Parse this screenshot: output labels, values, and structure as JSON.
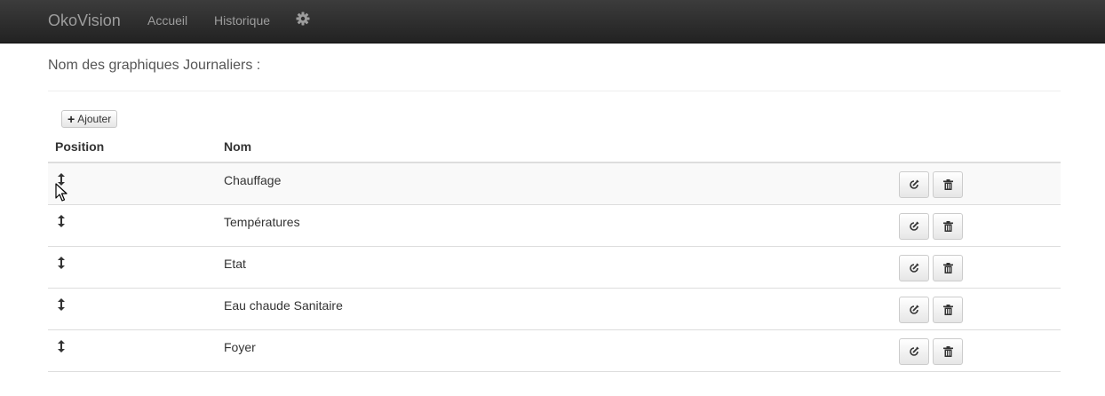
{
  "navbar": {
    "brand": "OkoVision",
    "links": [
      {
        "label": "Accueil"
      },
      {
        "label": "Historique"
      }
    ],
    "settings_icon": "gear-icon"
  },
  "page": {
    "heading": "Nom des graphiques Journaliers :"
  },
  "toolbar": {
    "add_label": "Ajouter",
    "add_icon": "plus-icon"
  },
  "table": {
    "columns": [
      "Position",
      "Nom"
    ],
    "rows": [
      {
        "name": "Chauffage"
      },
      {
        "name": "Températures"
      },
      {
        "name": "Etat"
      },
      {
        "name": "Eau chaude Sanitaire"
      },
      {
        "name": "Foyer"
      }
    ],
    "row_icons": {
      "position": "move-vertical-icon",
      "edit": "edit-icon",
      "delete": "trash-icon"
    }
  }
}
